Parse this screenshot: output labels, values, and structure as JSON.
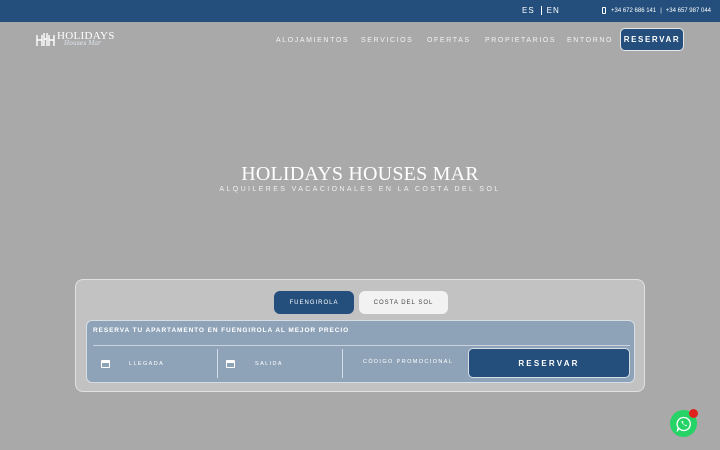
{
  "topbar": {
    "lang_es": "ES",
    "lang_en": "EN",
    "phone_1": "+34 672 686 141",
    "phone_divider": "|",
    "phone_2": "+34 657 987 044",
    "phone_icon": "mobile-phone-icon"
  },
  "logo": {
    "text": "HOLIDAYS",
    "script": "Houses Mar"
  },
  "nav": {
    "items": [
      "ALOJAMIENTOS",
      "SERVICIOS",
      "OFERTAS",
      "PROPIETARIOS",
      "ENTORNO"
    ],
    "reserve_label": "RESERVAR"
  },
  "hero": {
    "title": "HOLIDAYS HOUSES MAR",
    "subtitle": "ALQUILERES VACACIONALES EN LA COSTA DEL SOL"
  },
  "booking": {
    "tabs": [
      "FUENGIROLA",
      "COSTA DEL SOL"
    ],
    "active_tab": "FUENGIROLA",
    "title": "RESERVA TU APARTAMENTO EN FUENGIROLA AL MEJOR PRECIO",
    "arrival_label": "LLEGADA",
    "departure_label": "SALIDA",
    "promo_placeholder": "CÓDIGO PROMOCIONAL",
    "reserve_label": "RESERVAR",
    "calendar_icon": "calendar-icon"
  },
  "whatsapp": {
    "icon": "whatsapp-icon",
    "badge_icon": "notification-dot-icon"
  },
  "colors": {
    "primary": "#244f7c",
    "background": "#a9a9a9",
    "whatsapp": "#25d366"
  }
}
